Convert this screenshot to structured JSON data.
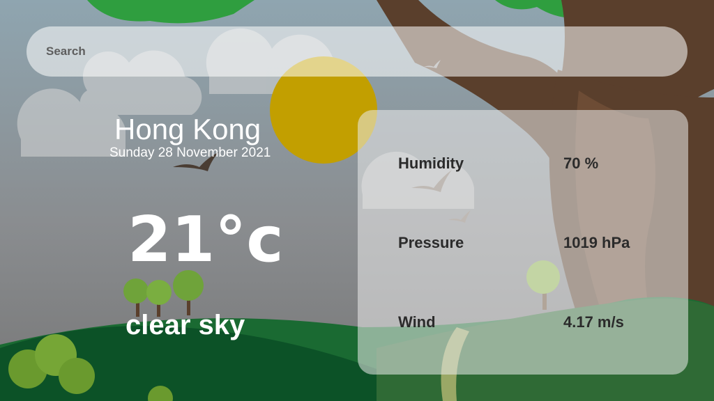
{
  "search": {
    "placeholder": "Search"
  },
  "location": {
    "city": "Hong Kong",
    "date": "Sunday 28 November 2021"
  },
  "current": {
    "temperature": "21°c",
    "description": "clear sky"
  },
  "details": [
    {
      "label": "Humidity",
      "value": "70 %"
    },
    {
      "label": "Pressure",
      "value": "1019 hPa"
    },
    {
      "label": "Wind",
      "value": "4.17 m/s"
    }
  ],
  "colors": {
    "sky_top": "#8ea4ae",
    "sky_bottom": "#7d7d7d",
    "sun": "#c9a400",
    "grass": "#0f5a2c",
    "hill": "#2f7a3a",
    "trunk": "#5a3f2c"
  }
}
